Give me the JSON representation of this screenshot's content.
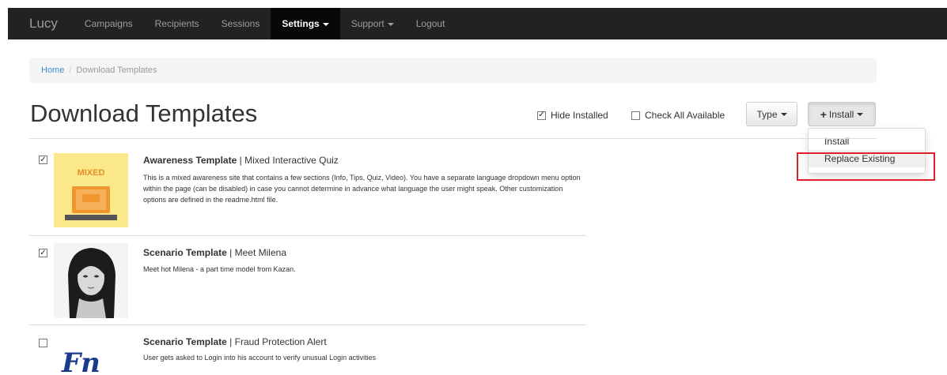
{
  "nav": {
    "brand": "Lucy",
    "items": [
      "Campaigns",
      "Recipients",
      "Sessions"
    ],
    "settings": "Settings",
    "support": "Support",
    "logout": "Logout"
  },
  "breadcrumb": {
    "home": "Home",
    "sep": "/",
    "current": "Download Templates"
  },
  "page": {
    "title": "Download Templates"
  },
  "toolbar": {
    "hide_installed": "Hide Installed",
    "hide_installed_checked": true,
    "check_all": "Check All Available",
    "check_all_checked": false,
    "type_button": "Type",
    "install_button": "Install"
  },
  "install_menu": {
    "items": [
      "Install",
      "Replace Existing"
    ],
    "highlighted": "Replace Existing"
  },
  "templates": [
    {
      "checked": true,
      "type": "Awareness Template",
      "sep": " | ",
      "name": "Mixed Interactive Quiz",
      "thumb_label": "MIXED",
      "description": "This is a mixed awareness site that contains a few sections (Info, Tips, Quiz, Video). You have a separate language dropdown menu option within the page (can be disabled) in case you cannot determine in advance what language the user might speak. Other customization options are defined in the readme.html file."
    },
    {
      "checked": true,
      "type": "Scenario Template",
      "sep": " | ",
      "name": "Meet Milena",
      "description": "Meet hot Milena - a part time model from Kazan."
    },
    {
      "checked": false,
      "type": "Scenario Template",
      "sep": " | ",
      "name": "Fraud Protection Alert",
      "thumb_label": "Fn",
      "description": "User gets asked to Login into his account to verify unusual Login activities"
    }
  ],
  "colors": {
    "navbar": "#222222",
    "link": "#428bca",
    "highlight": "#e0202a",
    "mixed_bg": "#fbe88a",
    "mixed_accent": "#f0962e"
  }
}
